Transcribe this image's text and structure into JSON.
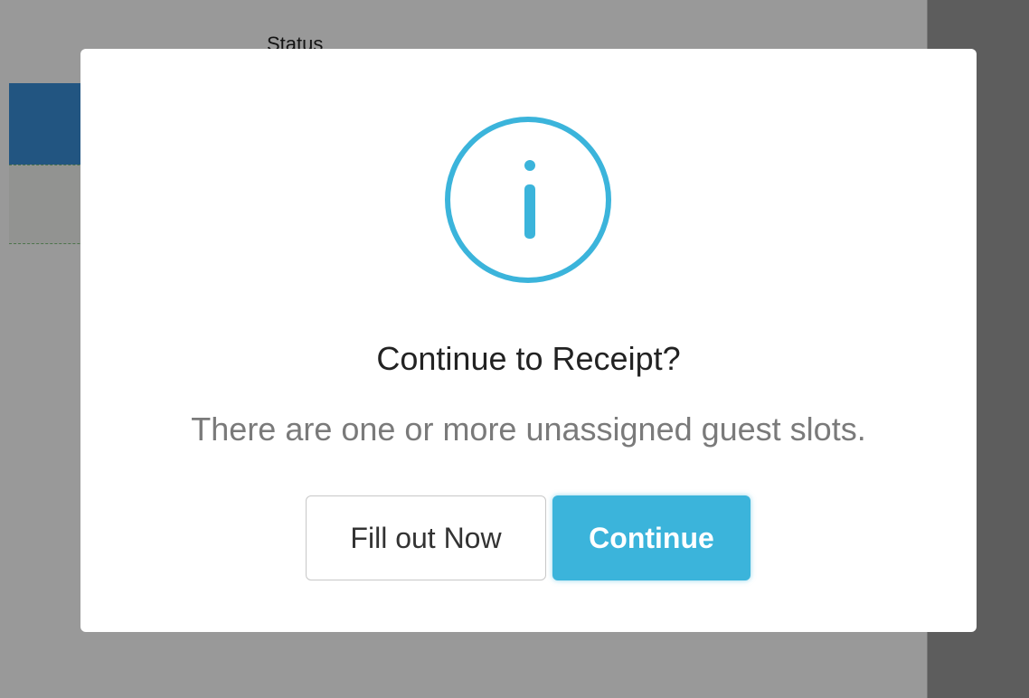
{
  "background": {
    "column_header": "Status"
  },
  "dialog": {
    "icon": "info-icon",
    "title": "Continue to Receipt?",
    "message": "There are one or more unassigned guest slots.",
    "buttons": {
      "secondary_label": "Fill out Now",
      "primary_label": "Continue"
    }
  },
  "colors": {
    "overlay": "#9b9b9b",
    "accent": "#3bb4db",
    "info_icon": "#3bb4db",
    "background_row": "#3a8ed8"
  }
}
